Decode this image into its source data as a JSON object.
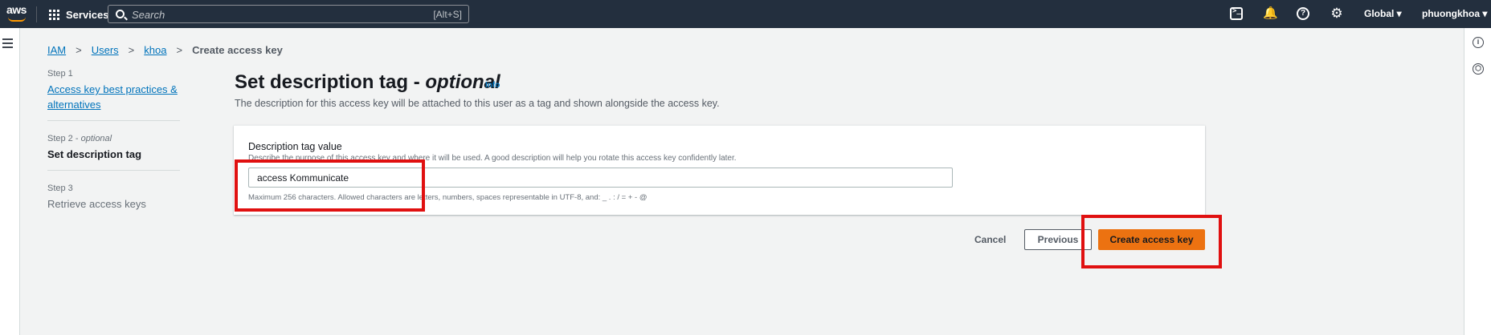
{
  "nav": {
    "logo_text": "aws",
    "services_label": "Services",
    "search_placeholder": "Search",
    "search_shortcut": "[Alt+S]",
    "region": "Global ▾",
    "user": "phuongkhoa ▾",
    "help_glyph": "?",
    "bell_glyph": "🔔",
    "gear_glyph": "⚙"
  },
  "rails": {
    "info_glyph": "i",
    "hex_glyph": "⬡"
  },
  "breadcrumb": {
    "items": [
      "IAM",
      "Users",
      "khoa"
    ],
    "separator": ">",
    "current": "Create access key"
  },
  "steps": [
    {
      "number": "Step 1",
      "title": "Access key best practices & alternatives",
      "state": "link"
    },
    {
      "number": "Step 2 - ",
      "number_suffix": "optional",
      "title": "Set description tag",
      "state": "active"
    },
    {
      "number": "Step 3",
      "title": "Retrieve access keys",
      "state": "inactive"
    }
  ],
  "page": {
    "title": "Set description tag - ",
    "title_suffix": "optional",
    "info_label": "Info",
    "description": "The description for this access key will be attached to this user as a tag and shown alongside the access key."
  },
  "form": {
    "label": "Description tag value",
    "hint": "Describe the purpose of this access key and where it will be used. A good description will help you rotate this access key confidently later.",
    "value": "access Kommunicate",
    "constraint": "Maximum 256 characters. Allowed characters are letters, numbers, spaces representable in UTF-8, and: _ . : / = + - @"
  },
  "actions": {
    "cancel": "Cancel",
    "previous": "Previous",
    "create": "Create access key"
  },
  "colors": {
    "nav_bg": "#232f3e",
    "link": "#0073bb",
    "primary_button": "#ec7211",
    "highlight": "#e01010"
  }
}
